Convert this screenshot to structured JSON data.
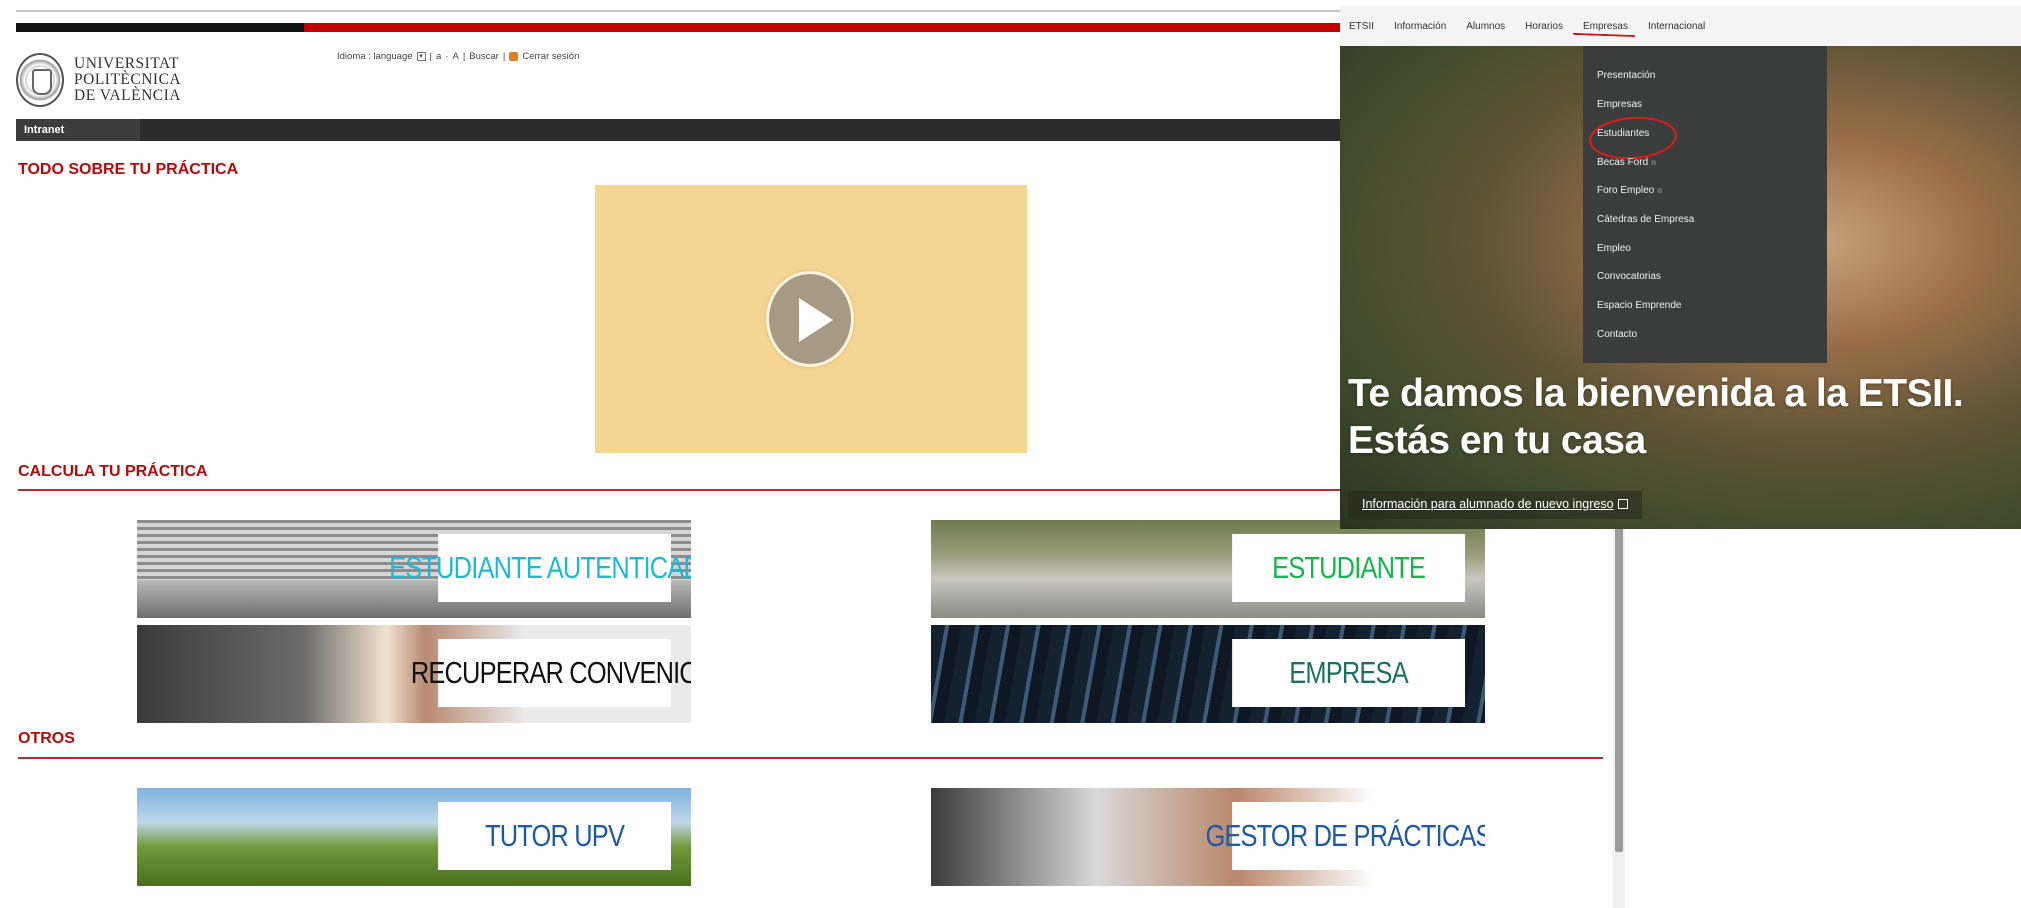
{
  "upv": {
    "logo": {
      "line1": "UNIVERSITAT",
      "line2": "POLITÈCNICA",
      "line3": "DE VALÈNCIA"
    },
    "toolbar": {
      "language": "Idioma : language",
      "lang_box": "▾",
      "sep1": "|",
      "text_small": "a",
      "dot": "·",
      "text_large": "A",
      "sep2": "|",
      "search": "Buscar",
      "sep3": "|",
      "logout": "Cerrar sesión"
    },
    "nav": {
      "intranet": "Intranet"
    },
    "sections": {
      "todo": "TODO SOBRE TU PRÁCTICA",
      "calcula": "CALCULA TU PRÁCTICA",
      "otros": "OTROS"
    },
    "banners": {
      "estudiante_autenticado": "ESTUDIANTE AUTENTICADO",
      "estudiante": "ESTUDIANTE",
      "recuperar_convenio": "RECUPERAR CONVENIO",
      "empresa": "EMPRESA",
      "tutor_upv": "TUTOR UPV",
      "gestor_practicas": "GESTOR DE PRÁCTICAS"
    },
    "colors": {
      "accent_red": "#b30b0b",
      "cyan_label": "#1db8d6",
      "green_label": "#14b54a",
      "teal_label": "#1f6e62",
      "blue_label": "#1d59a8"
    }
  },
  "etsii": {
    "nav": [
      "ETSII",
      "Información",
      "Alumnos",
      "Horarios",
      "Empresas",
      "Internacional"
    ],
    "active_nav": "Empresas",
    "dropdown": {
      "presentacion": "Presentación",
      "empresas": "Empresas",
      "estudiantes": "Estudiantes",
      "becas_ford": "Becas Ford",
      "foro_empleo": "Foro Empleo",
      "catedras": "Cátedras de Empresa",
      "empleo": "Empleo",
      "convocatorias": "Convocatorias",
      "espacio_emprende": "Espacio Emprende",
      "contacto": "Contacto",
      "external_mark": "⧉"
    },
    "hero": {
      "line1": "Te damos la bienvenida a la ETSII.",
      "line2": "Estás en tu casa",
      "link": "Información para alumnado de nuevo ingreso"
    },
    "annotation_color": "#e21a1a"
  }
}
